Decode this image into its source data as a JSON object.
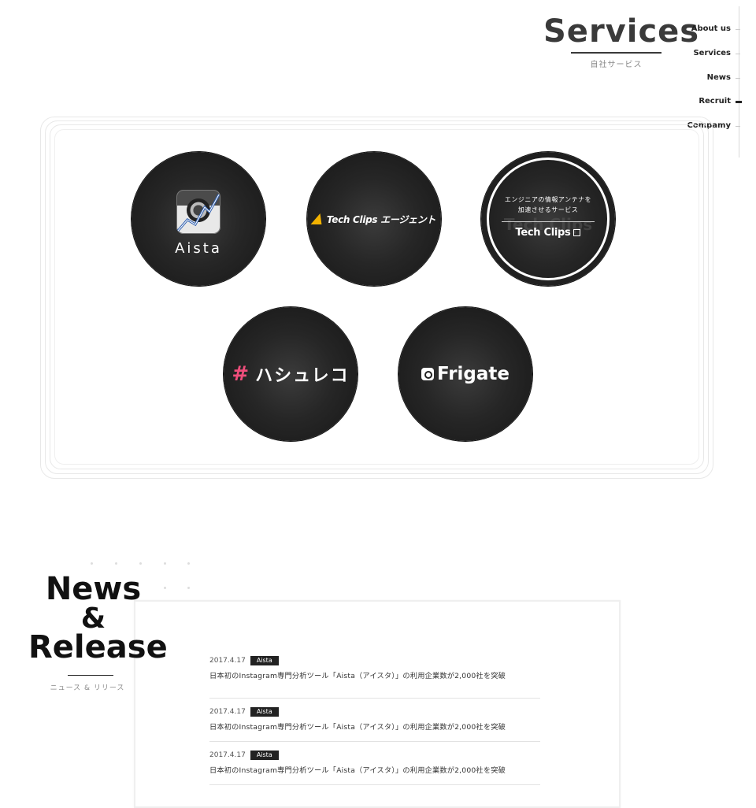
{
  "header": {
    "title": "Services",
    "subtitle": "自社サービス"
  },
  "nav": [
    {
      "label": "About us",
      "active": false
    },
    {
      "label": "Services",
      "active": false
    },
    {
      "label": "News",
      "active": false
    },
    {
      "label": "Recruit",
      "active": true
    },
    {
      "label": "Compamy",
      "active": false
    }
  ],
  "services": {
    "aista": {
      "name": "Aista"
    },
    "agent": {
      "name": "Tech Clips エージェント"
    },
    "techclips": {
      "tagline_1": "エンジニアの情報アンテナを",
      "tagline_2": "加速させるサービス",
      "ghost": "Tech Clips",
      "name": "Tech Clips"
    },
    "hashreco": {
      "name": "ハシュレコ",
      "mark": "#"
    },
    "frigate": {
      "name": "Frigate"
    }
  },
  "news": {
    "title_1": "News",
    "title_amp": "&",
    "title_2": "Release",
    "subtitle": "ニュース & リリース",
    "items": [
      {
        "date": "2017.4.17",
        "tag": "Aista",
        "text": "日本初のInstagram専門分析ツール「Aista（アイスタ）」の利用企業数が2,000社を突破"
      },
      {
        "date": "2017.4.17",
        "tag": "Aista",
        "text": "日本初のInstagram専門分析ツール「Aista（アイスタ）」の利用企業数が2,000社を突破"
      },
      {
        "date": "2017.4.17",
        "tag": "Aista",
        "text": "日本初のInstagram専門分析ツール「Aista（アイスタ）」の利用企業数が2,000社を突破"
      }
    ]
  },
  "colors": {
    "accent_pink": "#ef4e7b",
    "accent_gold": "#f2b200",
    "circle": "#1d1d1d"
  }
}
